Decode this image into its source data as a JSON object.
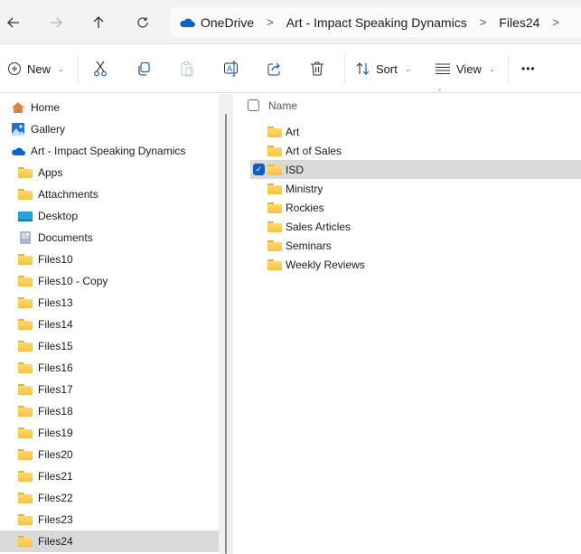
{
  "nav": {
    "back_icon": "arrow-left-icon",
    "forward_icon": "arrow-right-icon",
    "up_icon": "arrow-up-icon",
    "refresh_icon": "refresh-icon"
  },
  "breadcrumb": [
    "OneDrive",
    "Art - Impact Speaking Dynamics",
    "Files24"
  ],
  "toolbar": {
    "new_label": "New",
    "sort_label": "Sort",
    "view_label": "View",
    "more_label": "•••"
  },
  "sidebar": {
    "items": [
      {
        "label": "Home",
        "icon": "home-icon"
      },
      {
        "label": "Gallery",
        "icon": "gallery-icon"
      },
      {
        "label": "Art - Impact Speaking Dynamics",
        "icon": "onedrive-icon"
      },
      {
        "label": "Apps",
        "icon": "folder-icon"
      },
      {
        "label": "Attachments",
        "icon": "folder-icon"
      },
      {
        "label": "Desktop",
        "icon": "desktop-icon"
      },
      {
        "label": "Documents",
        "icon": "documents-icon"
      },
      {
        "label": "Files10",
        "icon": "folder-icon"
      },
      {
        "label": "Files10 - Copy",
        "icon": "folder-icon"
      },
      {
        "label": "Files13",
        "icon": "folder-icon"
      },
      {
        "label": "Files14",
        "icon": "folder-icon"
      },
      {
        "label": "Files15",
        "icon": "folder-icon"
      },
      {
        "label": "Files16",
        "icon": "folder-icon"
      },
      {
        "label": "Files17",
        "icon": "folder-icon"
      },
      {
        "label": "Files18",
        "icon": "folder-icon"
      },
      {
        "label": "Files19",
        "icon": "folder-icon"
      },
      {
        "label": "Files20",
        "icon": "folder-icon"
      },
      {
        "label": "Files21",
        "icon": "folder-icon"
      },
      {
        "label": "Files22",
        "icon": "folder-icon"
      },
      {
        "label": "Files23",
        "icon": "folder-icon"
      },
      {
        "label": "Files24",
        "icon": "folder-icon",
        "selected": true
      }
    ]
  },
  "content": {
    "column_header": "Name",
    "files": [
      {
        "name": "Art"
      },
      {
        "name": "Art of Sales"
      },
      {
        "name": "ISD",
        "selected": true
      },
      {
        "name": "Ministry"
      },
      {
        "name": "Rockies"
      },
      {
        "name": "Sales Articles"
      },
      {
        "name": "Seminars"
      },
      {
        "name": "Weekly Reviews"
      }
    ]
  }
}
